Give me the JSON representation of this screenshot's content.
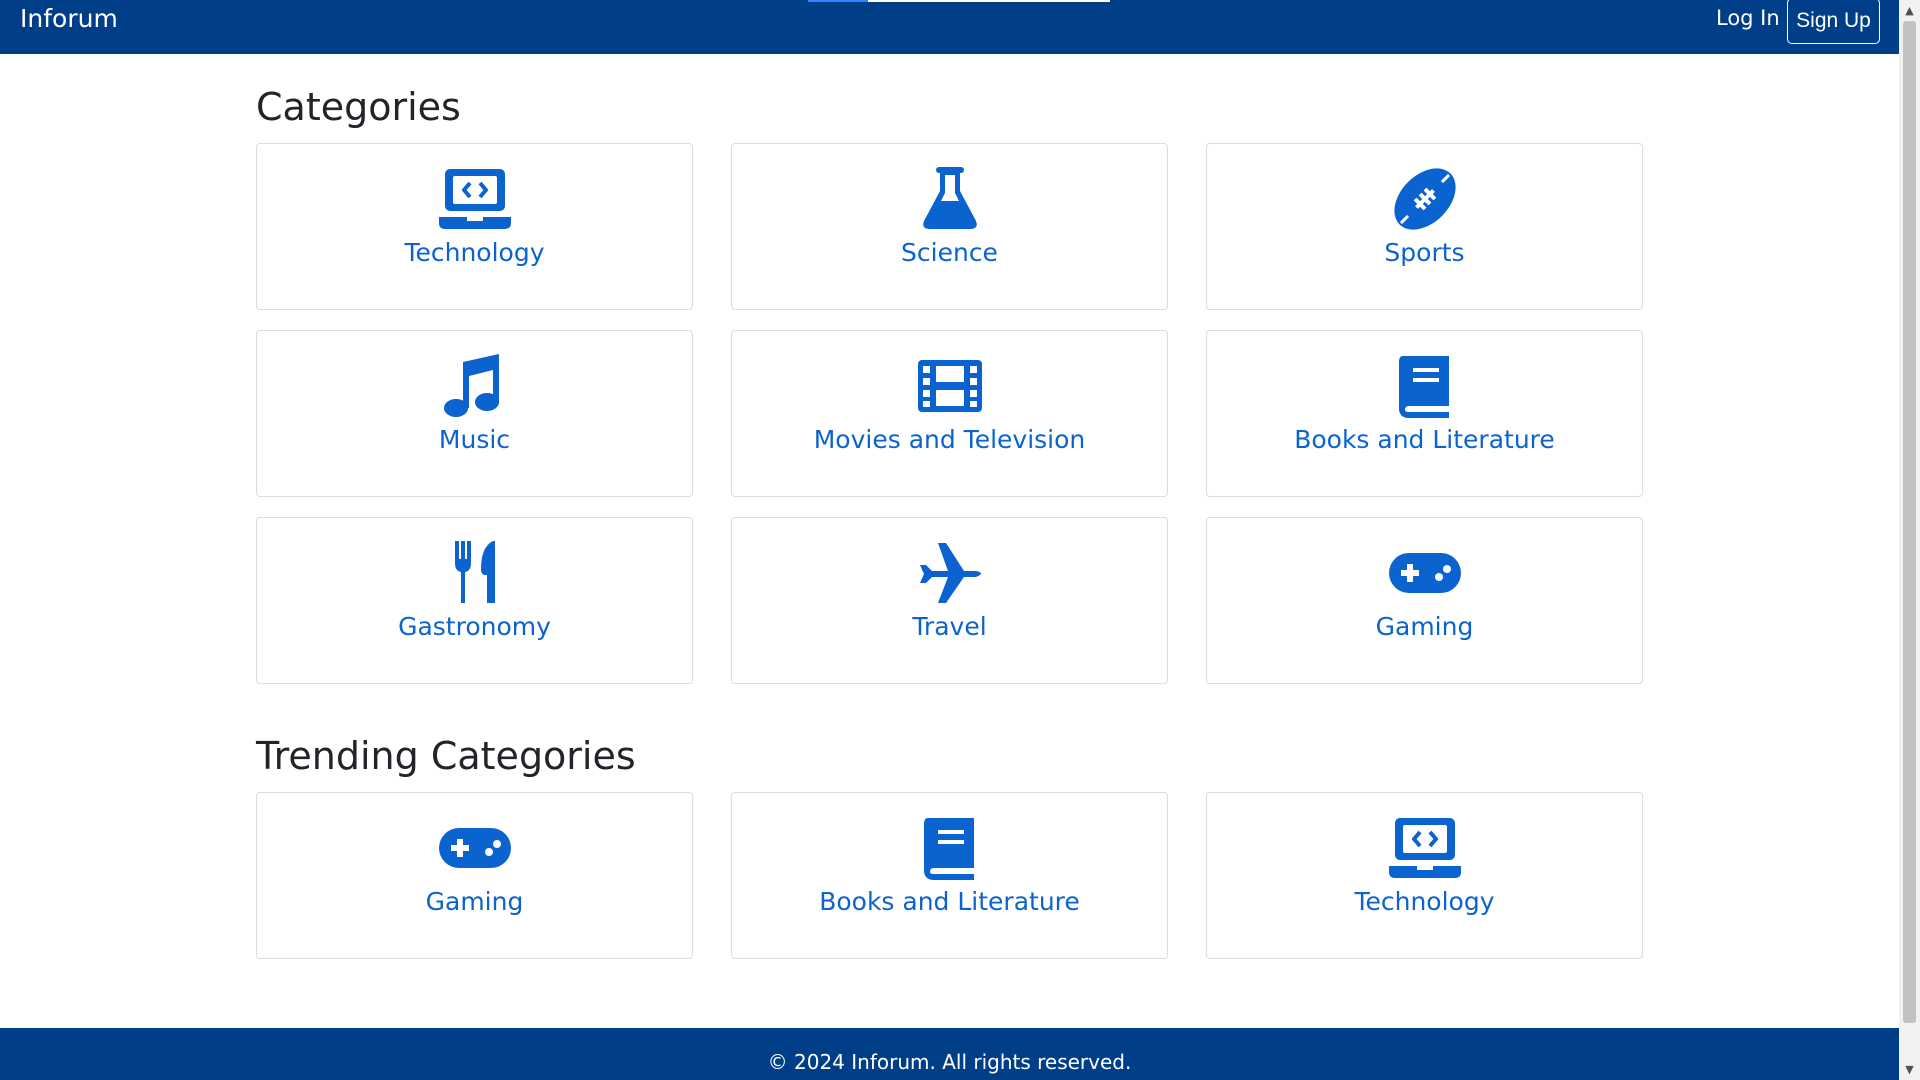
{
  "navbar": {
    "brand": "Inforum",
    "login_label": "Log In",
    "signup_label": "Sign Up"
  },
  "categories": {
    "title": "Categories",
    "items": [
      {
        "label": "Technology",
        "icon": "laptop-code-icon"
      },
      {
        "label": "Science",
        "icon": "flask-icon"
      },
      {
        "label": "Sports",
        "icon": "football-icon"
      },
      {
        "label": "Music",
        "icon": "music-icon"
      },
      {
        "label": "Movies and Television",
        "icon": "film-icon"
      },
      {
        "label": "Books and Literature",
        "icon": "book-icon"
      },
      {
        "label": "Gastronomy",
        "icon": "utensils-icon"
      },
      {
        "label": "Travel",
        "icon": "plane-icon"
      },
      {
        "label": "Gaming",
        "icon": "gamepad-icon"
      }
    ]
  },
  "trending": {
    "title": "Trending Categories",
    "items": [
      {
        "label": "Gaming",
        "icon": "gamepad-icon"
      },
      {
        "label": "Books and Literature",
        "icon": "book-icon"
      },
      {
        "label": "Technology",
        "icon": "laptop-code-icon"
      }
    ]
  },
  "footer": {
    "text": "© 2024 Inforum. All rights reserved."
  },
  "colors": {
    "navbar_bg": "#003f87",
    "accent": "#0b63cf"
  }
}
